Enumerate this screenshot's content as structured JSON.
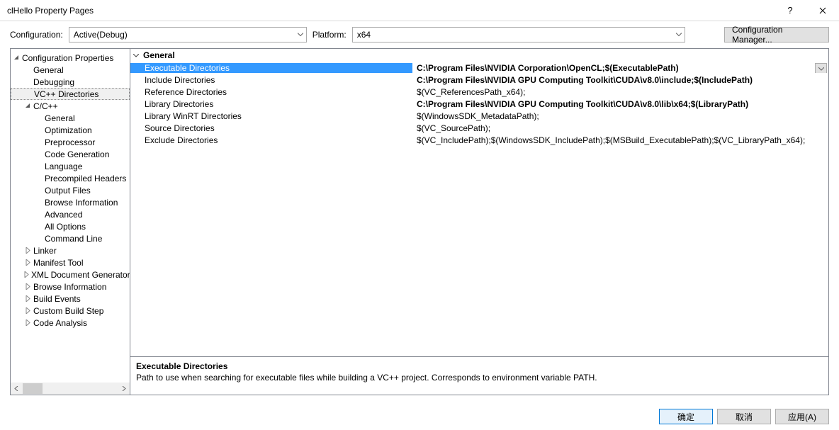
{
  "window": {
    "title": "clHello Property Pages"
  },
  "toprow": {
    "config_label": "Configuration:",
    "config_value": "Active(Debug)",
    "platform_label": "Platform:",
    "platform_value": "x64",
    "cfgmgr_label": "Configuration Manager..."
  },
  "tree": {
    "root": "Configuration Properties",
    "items": [
      {
        "label": "General",
        "level": 1
      },
      {
        "label": "Debugging",
        "level": 1
      },
      {
        "label": "VC++ Directories",
        "level": 1,
        "selected": true
      },
      {
        "label": "C/C++",
        "level": 1,
        "expandable": true,
        "expanded": true
      },
      {
        "label": "General",
        "level": 2
      },
      {
        "label": "Optimization",
        "level": 2
      },
      {
        "label": "Preprocessor",
        "level": 2
      },
      {
        "label": "Code Generation",
        "level": 2
      },
      {
        "label": "Language",
        "level": 2
      },
      {
        "label": "Precompiled Headers",
        "level": 2
      },
      {
        "label": "Output Files",
        "level": 2
      },
      {
        "label": "Browse Information",
        "level": 2
      },
      {
        "label": "Advanced",
        "level": 2
      },
      {
        "label": "All Options",
        "level": 2
      },
      {
        "label": "Command Line",
        "level": 2
      },
      {
        "label": "Linker",
        "level": 1,
        "expandable": true
      },
      {
        "label": "Manifest Tool",
        "level": 1,
        "expandable": true
      },
      {
        "label": "XML Document Generator",
        "level": 1,
        "expandable": true
      },
      {
        "label": "Browse Information",
        "level": 1,
        "expandable": true
      },
      {
        "label": "Build Events",
        "level": 1,
        "expandable": true
      },
      {
        "label": "Custom Build Step",
        "level": 1,
        "expandable": true
      },
      {
        "label": "Code Analysis",
        "level": 1,
        "expandable": true
      }
    ]
  },
  "grid": {
    "section": "General",
    "rows": [
      {
        "name": "Executable Directories",
        "value": "C:\\Program Files\\NVIDIA Corporation\\OpenCL;$(ExecutablePath)",
        "bold": true,
        "selected": true
      },
      {
        "name": "Include Directories",
        "value": "C:\\Program Files\\NVIDIA GPU Computing Toolkit\\CUDA\\v8.0\\include;$(IncludePath)",
        "bold": true
      },
      {
        "name": "Reference Directories",
        "value": "$(VC_ReferencesPath_x64);"
      },
      {
        "name": "Library Directories",
        "value": "C:\\Program Files\\NVIDIA GPU Computing Toolkit\\CUDA\\v8.0\\lib\\x64;$(LibraryPath)",
        "bold": true
      },
      {
        "name": "Library WinRT Directories",
        "value": "$(WindowsSDK_MetadataPath);"
      },
      {
        "name": "Source Directories",
        "value": "$(VC_SourcePath);"
      },
      {
        "name": "Exclude Directories",
        "value": "$(VC_IncludePath);$(WindowsSDK_IncludePath);$(MSBuild_ExecutablePath);$(VC_LibraryPath_x64);"
      }
    ]
  },
  "desc": {
    "title": "Executable Directories",
    "text": "Path to use when searching for executable files while building a VC++ project.  Corresponds to environment variable PATH."
  },
  "buttons": {
    "ok": "确定",
    "cancel": "取消",
    "apply": "应用(A)"
  }
}
